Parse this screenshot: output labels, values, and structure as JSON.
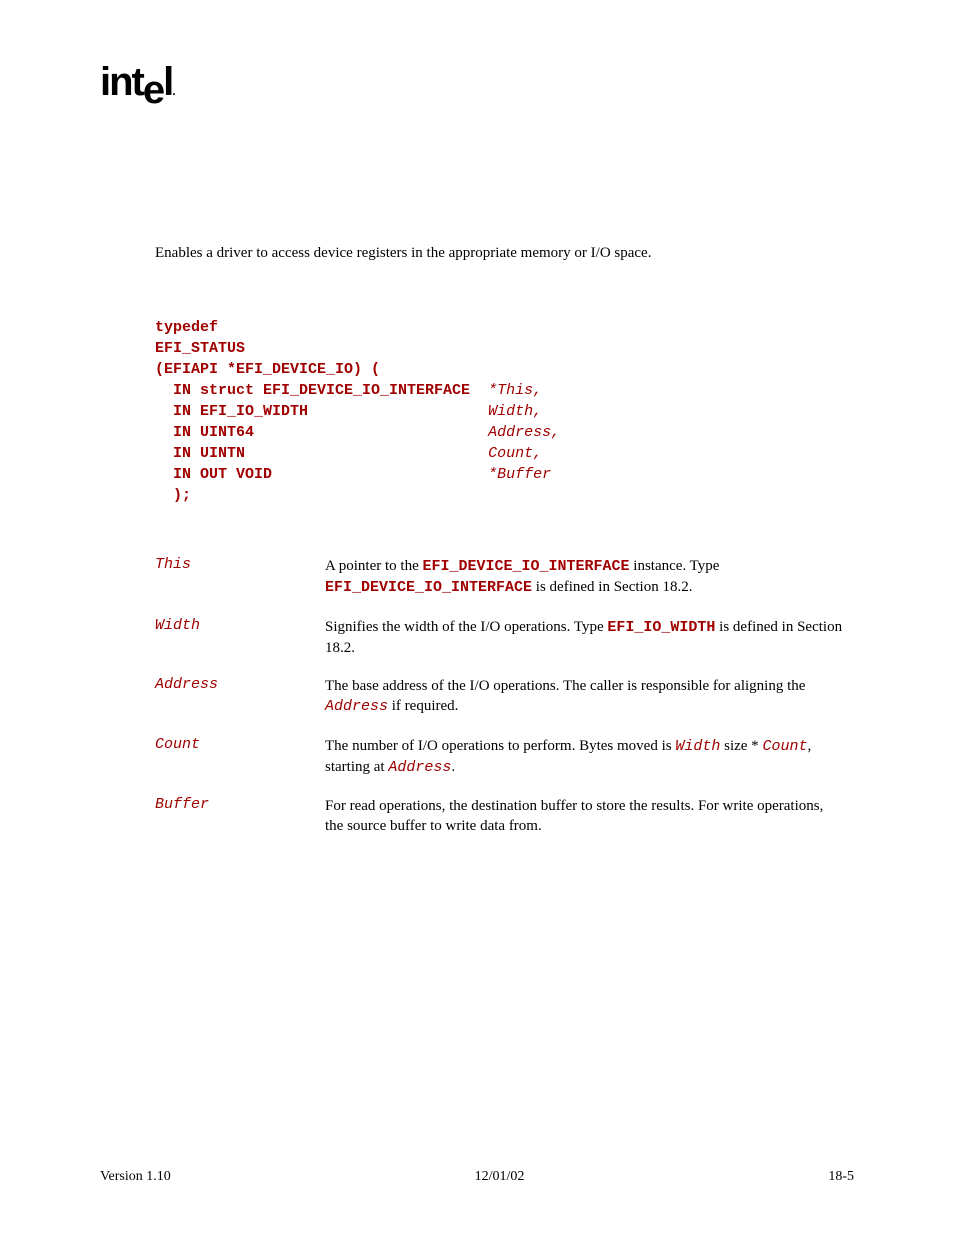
{
  "logo_text": "intel",
  "summary": "Enables a driver to access device registers in the appropriate memory or I/O space.",
  "code": {
    "line1": "typedef",
    "line2": "EFI_STATUS",
    "line3": "(EFIAPI *EFI_DEVICE_IO) (",
    "p1_type": "  IN struct EFI_DEVICE_IO_INTERFACE  ",
    "p1_name": "*This,",
    "p2_type": "  IN EFI_IO_WIDTH                    ",
    "p2_name": "Width,",
    "p3_type": "  IN UINT64                          ",
    "p3_name": "Address,",
    "p4_type": "  IN UINTN                           ",
    "p4_name": "Count,",
    "p5_type": "  IN OUT VOID                        ",
    "p5_name": "*Buffer",
    "close": "  );"
  },
  "params": {
    "this": {
      "name": "This",
      "d1": "A pointer to the ",
      "c1": "EFI_DEVICE_IO_INTERFACE",
      "d2": " instance.  Type ",
      "c2": "EFI_DEVICE_IO_INTERFACE",
      "d3": " is defined in Section 18.2."
    },
    "width": {
      "name": "Width",
      "d1": "Signifies the width of the I/O operations.  Type ",
      "c1": "EFI_IO_WIDTH",
      "d2": " is defined in Section 18.2."
    },
    "address": {
      "name": "Address",
      "d1": "The base address of the I/O operations.  The caller is responsible for aligning the ",
      "c1": "Address",
      "d2": " if required."
    },
    "count": {
      "name": "Count",
      "d1": "The number of I/O operations to perform.  Bytes moved is ",
      "c1": "Width",
      "d2": " size * ",
      "c2": "Count",
      "d3": ", starting at ",
      "c3": "Address",
      "d4": "."
    },
    "buffer": {
      "name": "Buffer",
      "d1": "For read operations, the destination buffer to store the results.  For write operations, the source buffer to write data from."
    }
  },
  "footer": {
    "left": "Version 1.10",
    "center": "12/01/02",
    "right": "18-5"
  }
}
